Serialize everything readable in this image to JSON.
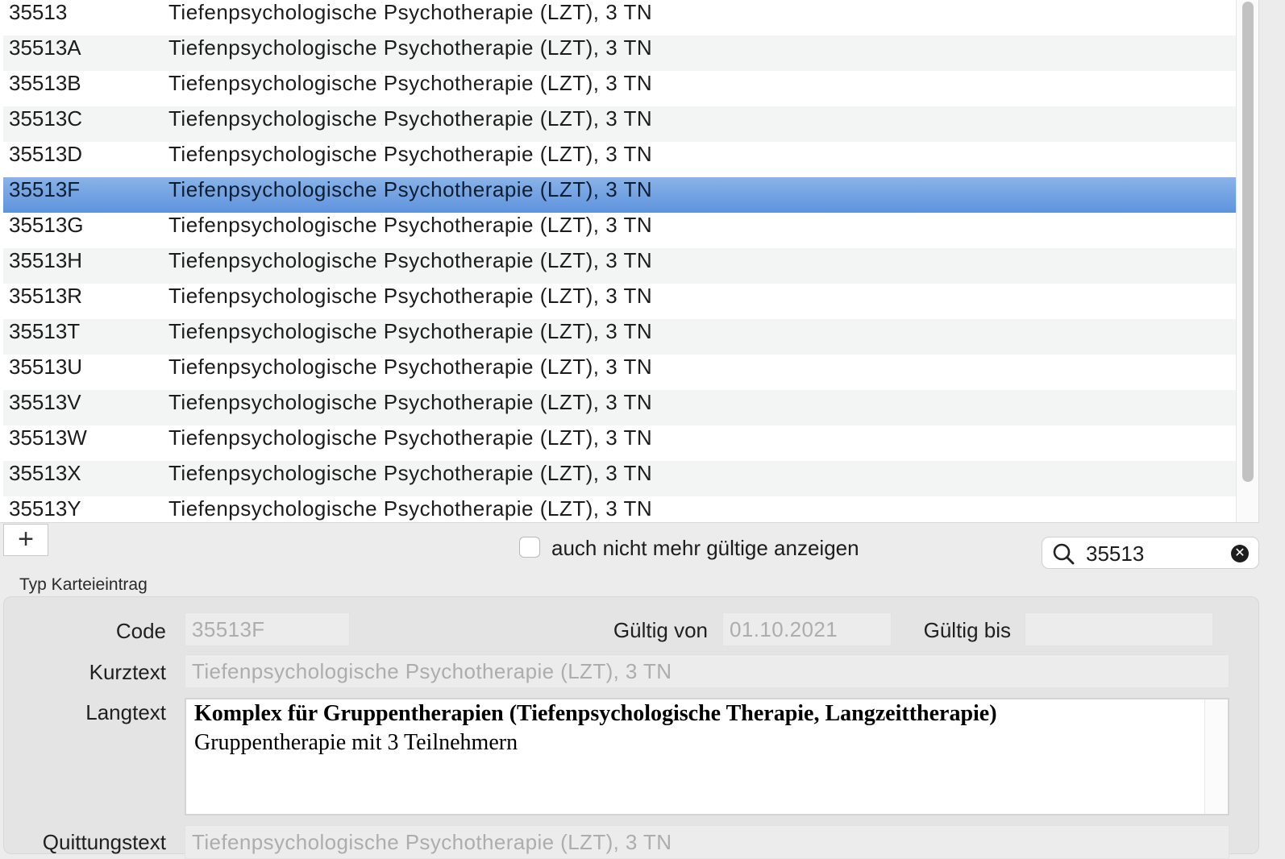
{
  "table": {
    "rows": [
      {
        "code": "35513",
        "desc": "Tiefenpsychologische Psychotherapie (LZT), 3 TN"
      },
      {
        "code": "35513A",
        "desc": "Tiefenpsychologische Psychotherapie (LZT), 3 TN"
      },
      {
        "code": "35513B",
        "desc": "Tiefenpsychologische Psychotherapie (LZT), 3 TN"
      },
      {
        "code": "35513C",
        "desc": "Tiefenpsychologische Psychotherapie (LZT), 3 TN"
      },
      {
        "code": "35513D",
        "desc": "Tiefenpsychologische Psychotherapie (LZT), 3 TN"
      },
      {
        "code": "35513F",
        "desc": "Tiefenpsychologische Psychotherapie (LZT), 3 TN",
        "selected": true
      },
      {
        "code": "35513G",
        "desc": "Tiefenpsychologische Psychotherapie (LZT), 3 TN"
      },
      {
        "code": "35513H",
        "desc": "Tiefenpsychologische Psychotherapie (LZT), 3 TN"
      },
      {
        "code": "35513R",
        "desc": "Tiefenpsychologische Psychotherapie (LZT), 3 TN"
      },
      {
        "code": "35513T",
        "desc": "Tiefenpsychologische Psychotherapie (LZT), 3 TN"
      },
      {
        "code": "35513U",
        "desc": "Tiefenpsychologische Psychotherapie (LZT), 3 TN"
      },
      {
        "code": "35513V",
        "desc": "Tiefenpsychologische Psychotherapie (LZT), 3 TN"
      },
      {
        "code": "35513W",
        "desc": "Tiefenpsychologische Psychotherapie (LZT), 3 TN"
      },
      {
        "code": "35513X",
        "desc": "Tiefenpsychologische Psychotherapie (LZT), 3 TN"
      },
      {
        "code": "35513Y",
        "desc": "Tiefenpsychologische Psychotherapie (LZT), 3 TN"
      }
    ]
  },
  "toolbar": {
    "add_label": "+",
    "show_invalid_label": "auch nicht mehr gültige anzeigen",
    "show_invalid_checked": false,
    "search_value": "35513",
    "search_icon": "magnifier-icon",
    "clear_icon": "clear-circle-icon"
  },
  "form": {
    "group_title": "Typ Karteieintrag",
    "code_label": "Code",
    "code_value": "35513F",
    "valid_from_label": "Gültig von",
    "valid_from_value": "01.10.2021",
    "valid_to_label": "Gültig bis",
    "valid_to_value": "",
    "short_text_label": "Kurztext",
    "short_text_value": "Tiefenpsychologische Psychotherapie (LZT), 3 TN",
    "long_text_label": "Langtext",
    "long_text_line1": "Komplex für Gruppentherapien (Tiefenpsychologische Therapie, Langzeittherapie)",
    "long_text_line2": "Gruppentherapie mit 3 Teilnehmern",
    "receipt_text_label": "Quittungstext",
    "receipt_text_value": "Tiefenpsychologische Psychotherapie (LZT), 3 TN"
  },
  "colors": {
    "selection": "#6a9fe2",
    "row_alt": "#f3f4f4",
    "background": "#ececec"
  }
}
